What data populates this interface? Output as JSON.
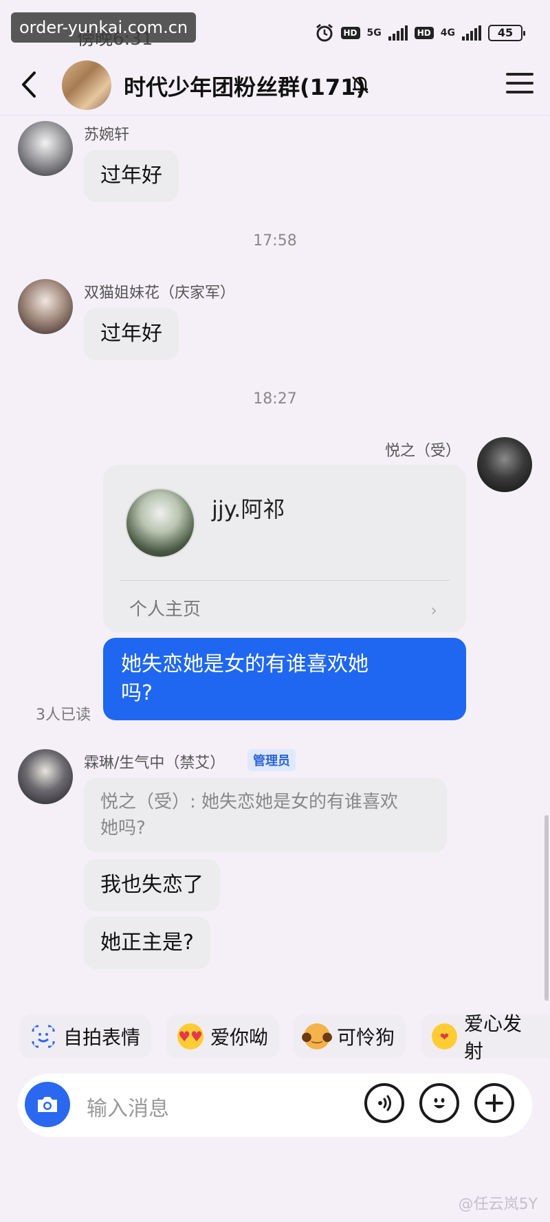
{
  "status_bar": {
    "watermark": "order-yunkai.com.cn",
    "time": "傍晚6:31",
    "hd1": "HD",
    "net1": "5G",
    "hd2": "HD",
    "net2": "4G",
    "battery": "45"
  },
  "header": {
    "title": "时代少年团粉丝群(171)"
  },
  "messages": {
    "m1": {
      "sender": "苏婉轩",
      "text": "过年好"
    },
    "t1": "17:58",
    "m2": {
      "sender": "双猫姐妹花（庆家军）",
      "text": "过年好"
    },
    "t2": "18:27",
    "m3": {
      "sender": "悦之（受）",
      "card_name": "jjy.阿祁",
      "card_link": "个人主页",
      "chevron": "›",
      "text_line1": "她失恋她是女的有谁喜欢她",
      "text_line2": "吗?",
      "read": "3人已读"
    },
    "m4": {
      "sender": "霖琳/生气中（禁艾）",
      "badge": "管理员",
      "quote_line1": "悦之（受）: 她失恋她是女的有谁喜欢",
      "quote_line2": "她吗?",
      "text1": "我也失恋了",
      "text2": "她正主是?"
    }
  },
  "stickers": [
    {
      "label": "自拍表情",
      "icon": "selfie-face-icon"
    },
    {
      "label": "爱你呦",
      "icon": "heart-eyes-icon"
    },
    {
      "label": "可怜狗",
      "icon": "dog-icon"
    },
    {
      "label": "爱心发射",
      "icon": "hearts-face-icon"
    }
  ],
  "input": {
    "placeholder": "输入消息"
  },
  "watermark_bottom": "@任云岚5Y",
  "colors": {
    "accent": "#1f67f0",
    "background": "#f5f0f8",
    "bubble": "#ecebee"
  }
}
